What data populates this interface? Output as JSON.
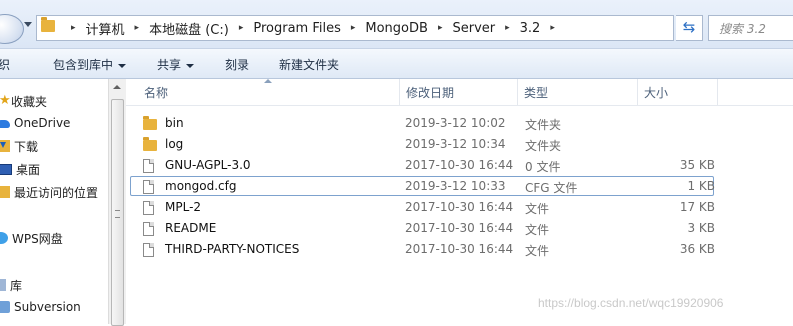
{
  "address_bar": {
    "breadcrumbs": [
      "计算机",
      "本地磁盘 (C:)",
      "Program Files",
      "MongoDB",
      "Server",
      "3.2"
    ],
    "separator": "▸",
    "search_placeholder": "搜索 3.2"
  },
  "toolbar": {
    "organize_label": "织",
    "include_in_library_label": "包含到库中",
    "share_label": "共享",
    "burn_label": "刻录",
    "new_folder_label": "新建文件夹"
  },
  "nav": {
    "items": [
      {
        "label": "收藏夹",
        "icon": "star-icon"
      },
      {
        "label": "OneDrive",
        "icon": "cloud-icon"
      },
      {
        "label": "下载",
        "icon": "download-folder-icon"
      },
      {
        "label": "桌面",
        "icon": "desktop-icon"
      },
      {
        "label": "最近访问的位置",
        "icon": "recent-places-icon"
      },
      {
        "label": "WPS网盘",
        "icon": "wps-cloud-icon"
      },
      {
        "label": "库",
        "icon": "library-icon"
      },
      {
        "label": "Subversion",
        "icon": "subversion-icon"
      }
    ]
  },
  "columns": {
    "name": "名称",
    "date": "修改日期",
    "type": "类型",
    "size": "大小"
  },
  "files": [
    {
      "name": "bin",
      "date": "2019-3-12 10:02",
      "type": "文件夹",
      "size": "",
      "kind": "folder"
    },
    {
      "name": "log",
      "date": "2019-3-12 10:34",
      "type": "文件夹",
      "size": "",
      "kind": "folder"
    },
    {
      "name": "GNU-AGPL-3.0",
      "date": "2017-10-30 16:44",
      "type": "0 文件",
      "size": "35 KB",
      "kind": "file"
    },
    {
      "name": "mongod.cfg",
      "date": "2019-3-12 10:33",
      "type": "CFG 文件",
      "size": "1 KB",
      "kind": "file",
      "selected": true
    },
    {
      "name": "MPL-2",
      "date": "2017-10-30 16:44",
      "type": "文件",
      "size": "17 KB",
      "kind": "file"
    },
    {
      "name": "README",
      "date": "2017-10-30 16:44",
      "type": "文件",
      "size": "3 KB",
      "kind": "file"
    },
    {
      "name": "THIRD-PARTY-NOTICES",
      "date": "2017-10-30 16:44",
      "type": "文件",
      "size": "36 KB",
      "kind": "file"
    }
  ],
  "watermark": "https://blog.csdn.net/wqc19920906"
}
